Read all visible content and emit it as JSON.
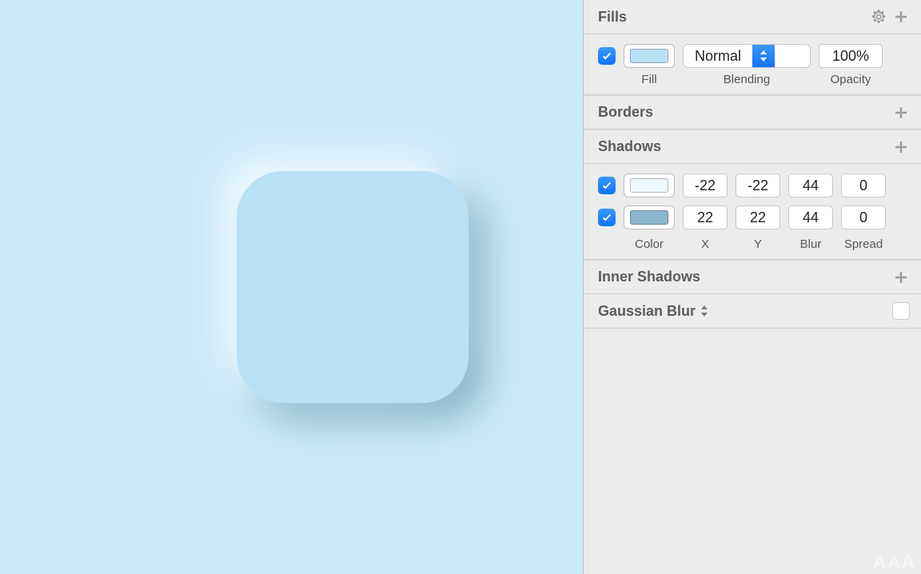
{
  "sections": {
    "fills": {
      "title": "Fills",
      "row": {
        "enabled": true,
        "fill_color": "#b7e1f4",
        "blend_mode": "Normal",
        "opacity": "100%"
      },
      "labels": {
        "fill": "Fill",
        "blending": "Blending",
        "opacity": "Opacity"
      }
    },
    "borders": {
      "title": "Borders"
    },
    "shadows": {
      "title": "Shadows",
      "rows": [
        {
          "enabled": true,
          "color": "#eef8fc",
          "x": "-22",
          "y": "-22",
          "blur": "44",
          "spread": "0"
        },
        {
          "enabled": true,
          "color": "#8cb7cc",
          "x": "22",
          "y": "22",
          "blur": "44",
          "spread": "0"
        }
      ],
      "labels": {
        "color": "Color",
        "x": "X",
        "y": "Y",
        "blur": "Blur",
        "spread": "Spread"
      }
    },
    "inner_shadows": {
      "title": "Inner Shadows"
    },
    "gaussian_blur": {
      "title": "Gaussian Blur",
      "enabled": false
    }
  },
  "watermark": "AAA"
}
